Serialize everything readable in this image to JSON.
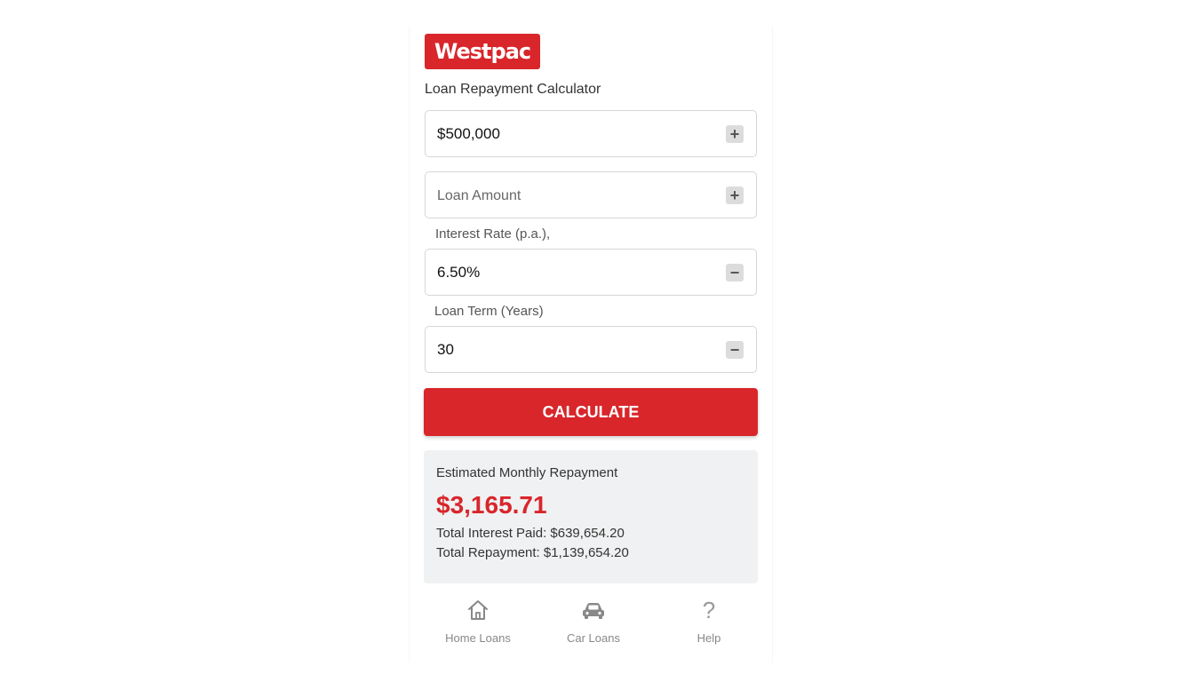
{
  "brand": {
    "logo_text": "Westpac",
    "color": "#d8262b"
  },
  "app": {
    "title": "Loan Repayment Calculator"
  },
  "form": {
    "field1": {
      "value": "$500,000",
      "stepper": "+"
    },
    "field2": {
      "placeholder": "Loan Amount",
      "value": "",
      "stepper": "+"
    },
    "interest": {
      "label": "Interest Rate (p.a.),",
      "value": "6.50%",
      "stepper": "−"
    },
    "term": {
      "label": "Loan Term (Years)",
      "value": "30",
      "stepper": "−"
    },
    "calculate_label": "CALCULATE"
  },
  "result": {
    "label": "Estimated Monthly Repayment",
    "monthly": "$3,165.71",
    "total_interest": "Total Interest Paid: $639,654.20",
    "total_repayment": "Total Repayment: $1,139,654.20"
  },
  "nav": {
    "items": [
      {
        "label": "Home Loans",
        "icon": "home-icon"
      },
      {
        "label": "Car Loans",
        "icon": "car-icon"
      },
      {
        "label": "Help",
        "icon": "help-icon",
        "glyph": "?"
      }
    ]
  }
}
